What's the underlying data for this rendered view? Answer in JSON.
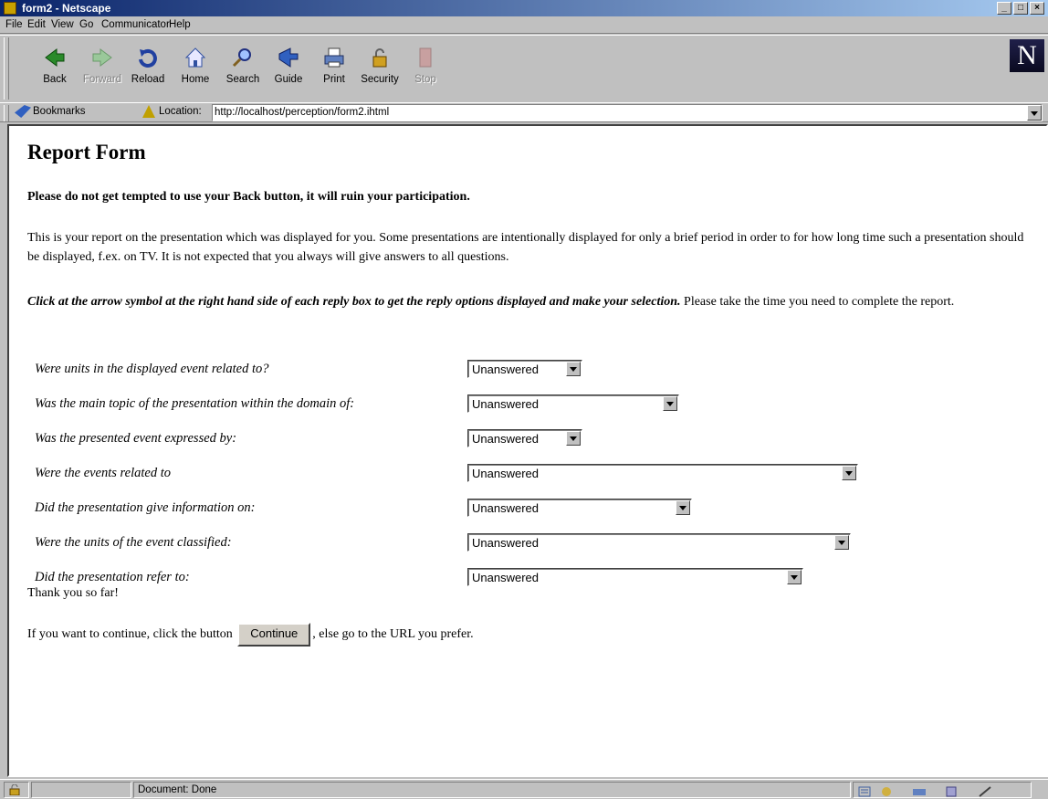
{
  "window": {
    "title": "form2 - Netscape",
    "controls": [
      "_",
      "□",
      "×"
    ]
  },
  "menu": [
    "File",
    "Edit",
    "View",
    "Go",
    "Communicator",
    "Help"
  ],
  "toolbar": {
    "buttons": [
      {
        "label": "Back",
        "icon": "back-arrow-icon",
        "enabled": true
      },
      {
        "label": "Forward",
        "icon": "forward-arrow-icon",
        "enabled": false
      },
      {
        "label": "Reload",
        "icon": "reload-icon",
        "enabled": true
      },
      {
        "label": "Home",
        "icon": "home-icon",
        "enabled": true
      },
      {
        "label": "Search",
        "icon": "search-icon",
        "enabled": true
      },
      {
        "label": "Guide",
        "icon": "guide-icon",
        "enabled": true
      },
      {
        "label": "Print",
        "icon": "print-icon",
        "enabled": true
      },
      {
        "label": "Security",
        "icon": "security-lock-icon",
        "enabled": true
      },
      {
        "label": "Stop",
        "icon": "stop-icon",
        "enabled": false
      }
    ],
    "logo": "N"
  },
  "location": {
    "bookmarks_label": "Bookmarks",
    "label": "Location:",
    "url": "http://localhost/perception/form2.ihtml"
  },
  "page": {
    "heading": "Report Form",
    "warning": "Please do not get tempted to use your Back button, it will ruin your participation.",
    "intro": "This is your report on the presentation which was displayed for you. Some presentations are intentionally displayed for only a brief period in order to for how long time such a presentation should be displayed, f.ex. on TV. It is not expected that you always will give answers to all questions.",
    "instruction_emphasis": "Click at the arrow symbol at the right hand side of each reply box to get the reply options displayed and make your selection.",
    "instruction_rest": " Please take the time you need to complete the report.",
    "questions": [
      {
        "text": "Were units in the displayed event related to?",
        "value": "Unanswered"
      },
      {
        "text": "Was the main topic of the presentation within the domain of:",
        "value": "Unanswered"
      },
      {
        "text": "Was the presented event expressed by:",
        "value": "Unanswered"
      },
      {
        "text": "Were the events related to",
        "value": "Unanswered"
      },
      {
        "text": "Did the presentation give information on:",
        "value": "Unanswered"
      },
      {
        "text": "Were the units of the event classified:",
        "value": "Unanswered"
      },
      {
        "text": "Did the presentation refer to:",
        "value": "Unanswered"
      }
    ],
    "thanks": "Thank you so far!",
    "continue_before": "If you want to continue, click the button ",
    "continue_button": "Continue",
    "continue_after": ", else go to the URL you prefer."
  },
  "status": {
    "text": "Document: Done"
  }
}
